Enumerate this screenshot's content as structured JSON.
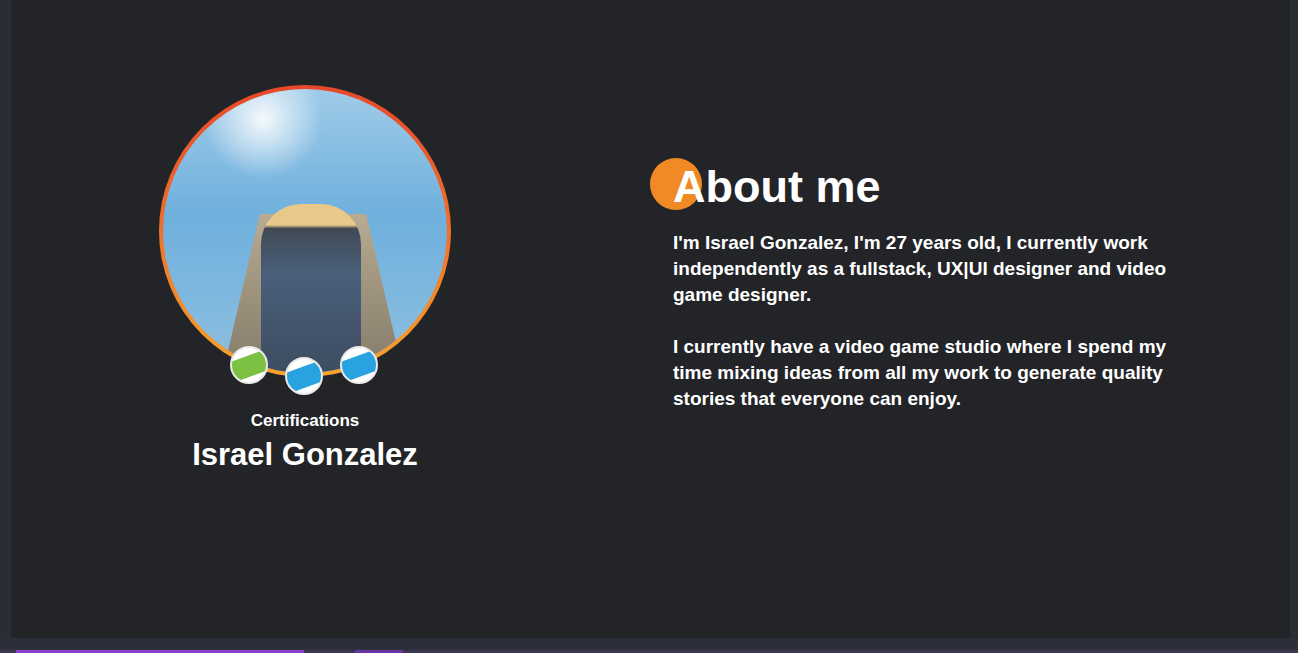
{
  "profile": {
    "name": "Israel Gonzalez",
    "certifications": {
      "label": "Certifications",
      "badges": [
        {
          "color": "#7cc242"
        },
        {
          "color": "#29a3e0"
        },
        {
          "color": "#29a3e0"
        }
      ]
    }
  },
  "about": {
    "title": "About me",
    "paragraphs": [
      "I'm Israel Gonzalez, I'm 27 years old, I currently work independently as a fullstack, UX|UI designer and video game designer.",
      "I currently have a video game studio where I spend my time mixing ideas from all my work to generate quality stories that everyone can enjoy."
    ]
  }
}
